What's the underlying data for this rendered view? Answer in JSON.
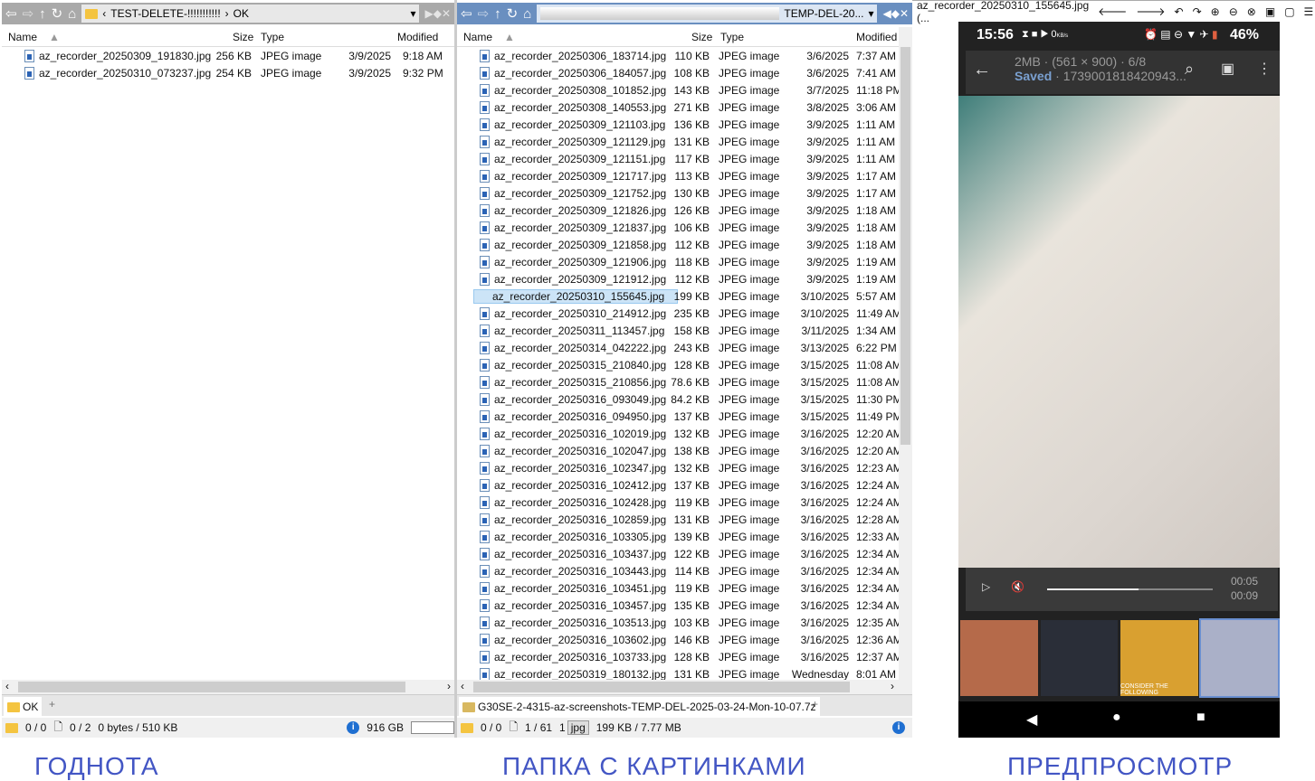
{
  "left_panel": {
    "path_parts": [
      "TEST-DELETE-!!!!!!!!!!!",
      "OK"
    ],
    "columns": {
      "name": "Name",
      "size": "Size",
      "type": "Type",
      "modified": "Modified"
    },
    "rows": [
      [
        "az_recorder_20250309_191830.jpg",
        "256 KB",
        "JPEG image",
        "3/9/2025",
        "9:18 AM"
      ],
      [
        "az_recorder_20250310_073237.jpg",
        "254 KB",
        "JPEG image",
        "3/9/2025",
        "9:32 PM"
      ]
    ],
    "tab": "OK",
    "status": {
      "folders": "0 / 0",
      "files": "0 / 2",
      "bytes": "0 bytes / 510 KB",
      "free": "916 GB"
    }
  },
  "right_panel": {
    "path": "TEMP-DEL-20...",
    "columns": {
      "name": "Name",
      "size": "Size",
      "type": "Type",
      "modified": "Modified"
    },
    "selected_index": 14,
    "rows": [
      [
        "az_recorder_20250306_183714.jpg",
        "110 KB",
        "JPEG image",
        "3/6/2025",
        "7:37 AM"
      ],
      [
        "az_recorder_20250306_184057.jpg",
        "108 KB",
        "JPEG image",
        "3/6/2025",
        "7:41 AM"
      ],
      [
        "az_recorder_20250308_101852.jpg",
        "143 KB",
        "JPEG image",
        "3/7/2025",
        "11:18 PM"
      ],
      [
        "az_recorder_20250308_140553.jpg",
        "271 KB",
        "JPEG image",
        "3/8/2025",
        "3:06 AM"
      ],
      [
        "az_recorder_20250309_121103.jpg",
        "136 KB",
        "JPEG image",
        "3/9/2025",
        "1:11 AM"
      ],
      [
        "az_recorder_20250309_121129.jpg",
        "131 KB",
        "JPEG image",
        "3/9/2025",
        "1:11 AM"
      ],
      [
        "az_recorder_20250309_121151.jpg",
        "117 KB",
        "JPEG image",
        "3/9/2025",
        "1:11 AM"
      ],
      [
        "az_recorder_20250309_121717.jpg",
        "113 KB",
        "JPEG image",
        "3/9/2025",
        "1:17 AM"
      ],
      [
        "az_recorder_20250309_121752.jpg",
        "130 KB",
        "JPEG image",
        "3/9/2025",
        "1:17 AM"
      ],
      [
        "az_recorder_20250309_121826.jpg",
        "126 KB",
        "JPEG image",
        "3/9/2025",
        "1:18 AM"
      ],
      [
        "az_recorder_20250309_121837.jpg",
        "106 KB",
        "JPEG image",
        "3/9/2025",
        "1:18 AM"
      ],
      [
        "az_recorder_20250309_121858.jpg",
        "112 KB",
        "JPEG image",
        "3/9/2025",
        "1:18 AM"
      ],
      [
        "az_recorder_20250309_121906.jpg",
        "118 KB",
        "JPEG image",
        "3/9/2025",
        "1:19 AM"
      ],
      [
        "az_recorder_20250309_121912.jpg",
        "112 KB",
        "JPEG image",
        "3/9/2025",
        "1:19 AM"
      ],
      [
        "az_recorder_20250310_155645.jpg",
        "199 KB",
        "JPEG image",
        "3/10/2025",
        "5:57 AM"
      ],
      [
        "az_recorder_20250310_214912.jpg",
        "235 KB",
        "JPEG image",
        "3/10/2025",
        "11:49 AM"
      ],
      [
        "az_recorder_20250311_113457.jpg",
        "158 KB",
        "JPEG image",
        "3/11/2025",
        "1:34 AM"
      ],
      [
        "az_recorder_20250314_042222.jpg",
        "243 KB",
        "JPEG image",
        "3/13/2025",
        "6:22 PM"
      ],
      [
        "az_recorder_20250315_210840.jpg",
        "128 KB",
        "JPEG image",
        "3/15/2025",
        "11:08 AM"
      ],
      [
        "az_recorder_20250315_210856.jpg",
        "78.6 KB",
        "JPEG image",
        "3/15/2025",
        "11:08 AM"
      ],
      [
        "az_recorder_20250316_093049.jpg",
        "84.2 KB",
        "JPEG image",
        "3/15/2025",
        "11:30 PM"
      ],
      [
        "az_recorder_20250316_094950.jpg",
        "137 KB",
        "JPEG image",
        "3/15/2025",
        "11:49 PM"
      ],
      [
        "az_recorder_20250316_102019.jpg",
        "132 KB",
        "JPEG image",
        "3/16/2025",
        "12:20 AM"
      ],
      [
        "az_recorder_20250316_102047.jpg",
        "138 KB",
        "JPEG image",
        "3/16/2025",
        "12:20 AM"
      ],
      [
        "az_recorder_20250316_102347.jpg",
        "132 KB",
        "JPEG image",
        "3/16/2025",
        "12:23 AM"
      ],
      [
        "az_recorder_20250316_102412.jpg",
        "137 KB",
        "JPEG image",
        "3/16/2025",
        "12:24 AM"
      ],
      [
        "az_recorder_20250316_102428.jpg",
        "119 KB",
        "JPEG image",
        "3/16/2025",
        "12:24 AM"
      ],
      [
        "az_recorder_20250316_102859.jpg",
        "131 KB",
        "JPEG image",
        "3/16/2025",
        "12:28 AM"
      ],
      [
        "az_recorder_20250316_103305.jpg",
        "139 KB",
        "JPEG image",
        "3/16/2025",
        "12:33 AM"
      ],
      [
        "az_recorder_20250316_103437.jpg",
        "122 KB",
        "JPEG image",
        "3/16/2025",
        "12:34 AM"
      ],
      [
        "az_recorder_20250316_103443.jpg",
        "114 KB",
        "JPEG image",
        "3/16/2025",
        "12:34 AM"
      ],
      [
        "az_recorder_20250316_103451.jpg",
        "119 KB",
        "JPEG image",
        "3/16/2025",
        "12:34 AM"
      ],
      [
        "az_recorder_20250316_103457.jpg",
        "135 KB",
        "JPEG image",
        "3/16/2025",
        "12:34 AM"
      ],
      [
        "az_recorder_20250316_103513.jpg",
        "103 KB",
        "JPEG image",
        "3/16/2025",
        "12:35 AM"
      ],
      [
        "az_recorder_20250316_103602.jpg",
        "146 KB",
        "JPEG image",
        "3/16/2025",
        "12:36 AM"
      ],
      [
        "az_recorder_20250316_103733.jpg",
        "128 KB",
        "JPEG image",
        "3/16/2025",
        "12:37 AM"
      ],
      [
        "az_recorder_20250319_180132.jpg",
        "131 KB",
        "JPEG image",
        "Wednesday",
        "8:01 AM"
      ]
    ],
    "tab": "G30SE-2-4315-az-screenshots-TEMP-DEL-2025-03-24-Mon-10-07.7z",
    "status": {
      "folders": "0 / 0",
      "files": "1 / 61",
      "ext_count": "1",
      "ext": "jpg",
      "bytes": "199 KB / 7.77 MB"
    }
  },
  "preview": {
    "title": "az_recorder_20250310_155645.jpg (...",
    "phone": {
      "time": "15:56",
      "net_speed": "0",
      "net_unit": "KB/s",
      "battery": "46%",
      "info_line": "2MB · (561 × 900) · 6/8",
      "saved": "Saved",
      "saved_rest": " · 1739001818420943...",
      "elapsed": "00:05",
      "duration": "00:09",
      "progress": 0.55,
      "thumb_labels": [
        "CONSIDER THE FOLLOWING"
      ]
    }
  },
  "captions": {
    "left": "ГОДНОТА",
    "middle": "ПАПКА С КАРТИНКАМИ",
    "right": "ПРЕДПРОСМОТР"
  },
  "colors": {
    "accent": "#6a8fc0",
    "caption": "#4356c4",
    "selection": "#cce4f7"
  }
}
